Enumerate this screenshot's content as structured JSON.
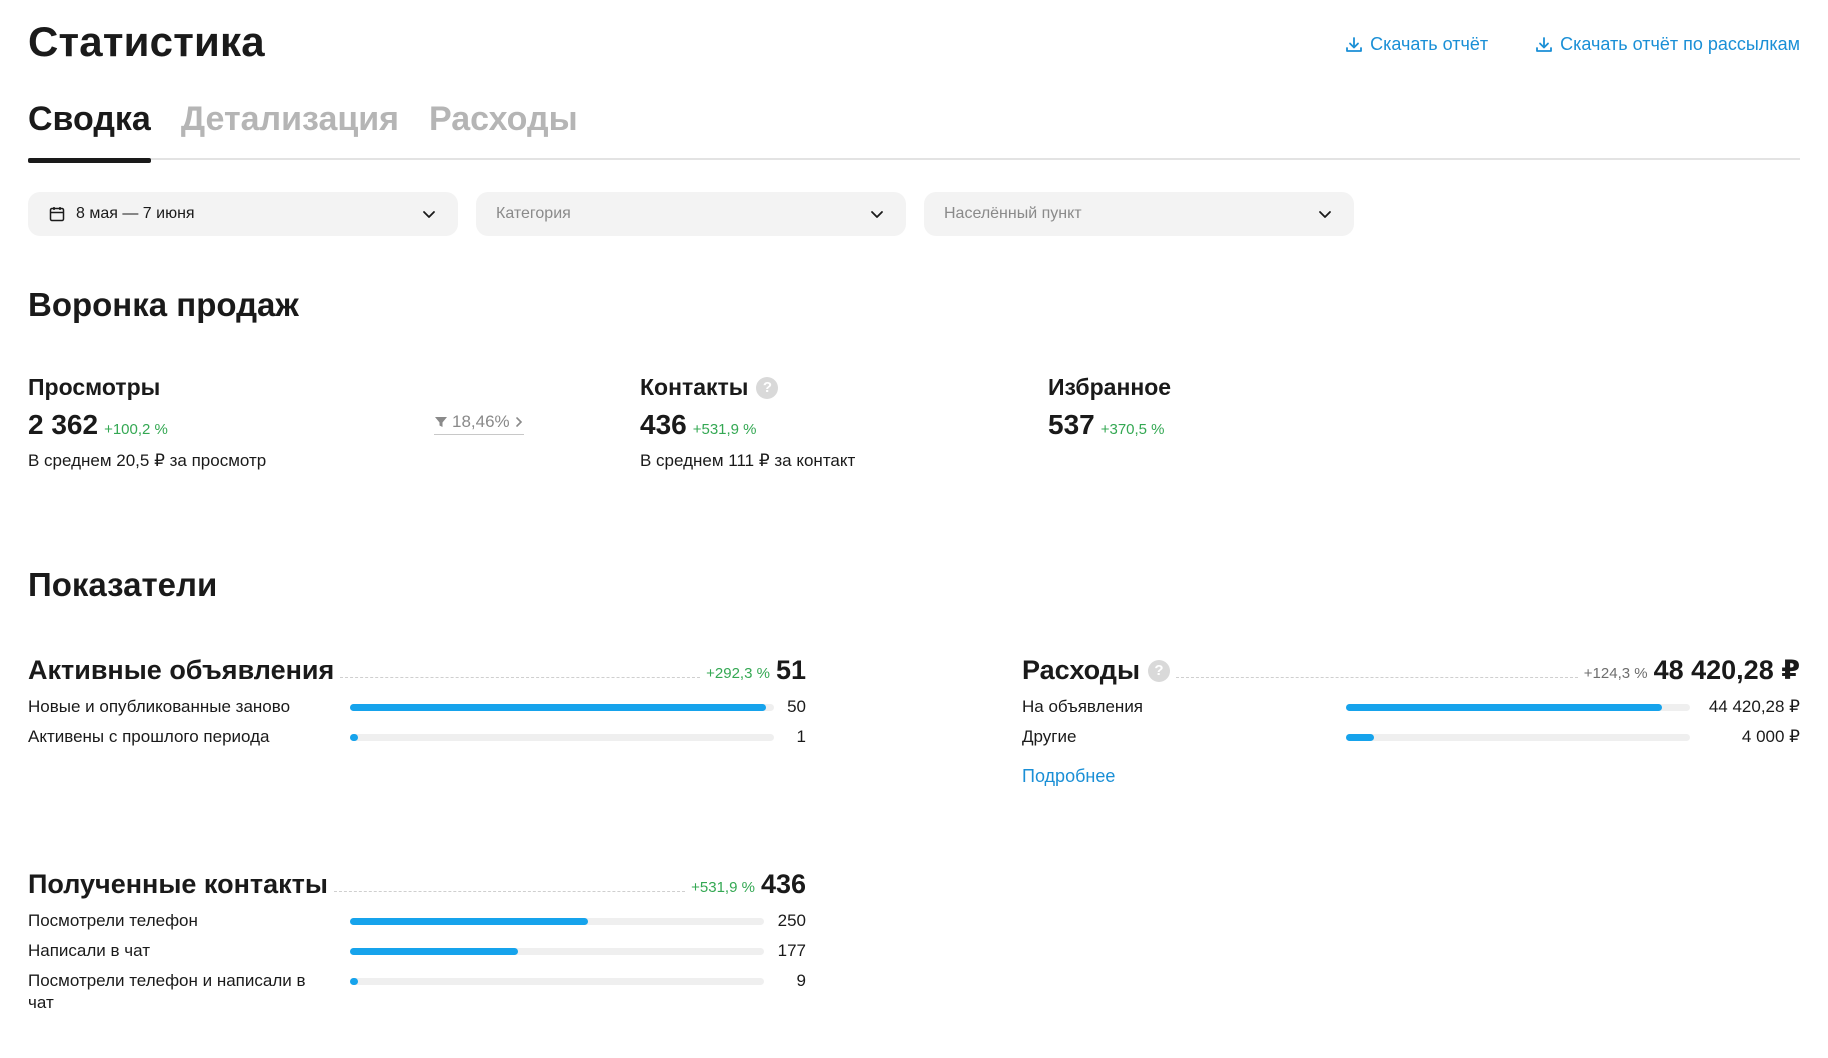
{
  "header": {
    "title": "Статистика",
    "download_report": "Скачать отчёт",
    "download_mailing_report": "Скачать отчёт по рассылкам"
  },
  "tabs": [
    {
      "label": "Сводка",
      "active": true
    },
    {
      "label": "Детализация",
      "active": false
    },
    {
      "label": "Расходы",
      "active": false
    }
  ],
  "filters": {
    "period": "8 мая — 7 июня",
    "category_placeholder": "Категория",
    "city_placeholder": "Населённый пункт"
  },
  "funnel": {
    "title": "Воронка продаж",
    "views": {
      "label": "Просмотры",
      "value": "2 362",
      "delta": "+100,2 %",
      "avg": "В среднем 20,5 ₽ за просмотр"
    },
    "conversion": "18,46%",
    "contacts": {
      "label": "Контакты",
      "value": "436",
      "delta": "+531,9 %",
      "avg": "В среднем 111 ₽ за контакт"
    },
    "favorites": {
      "label": "Избранное",
      "value": "537",
      "delta": "+370,5 %"
    }
  },
  "indicators": {
    "title": "Показатели",
    "active_ads": {
      "title": "Активные объявления",
      "delta": "+292,3 %",
      "total": "51",
      "rows": [
        {
          "label": "Новые и опубликованные заново",
          "value": "50",
          "fraction": 0.98
        },
        {
          "label": "Активены с прошлого периода",
          "value": "1",
          "fraction": 0.02
        }
      ]
    },
    "expenses": {
      "title": "Расходы",
      "delta": "+124,3 %",
      "total": "48 420,28 ₽",
      "rows": [
        {
          "label": "На объявления",
          "value": "44 420,28 ₽",
          "fraction": 0.92
        },
        {
          "label": "Другие",
          "value": "4 000 ₽",
          "fraction": 0.08
        }
      ],
      "more": "Подробнее"
    },
    "contacts": {
      "title": "Полученные контакты",
      "delta": "+531,9 %",
      "total": "436",
      "rows": [
        {
          "label": "Посмотрели телефон",
          "value": "250",
          "fraction": 0.574
        },
        {
          "label": "Написали в чат",
          "value": "177",
          "fraction": 0.406
        },
        {
          "label": "Посмотрели телефон и написали в чат",
          "value": "9",
          "fraction": 0.02
        }
      ]
    }
  },
  "colors": {
    "accent": "#1a8fd6",
    "bar": "#16a3ec",
    "positive": "#34a853"
  }
}
